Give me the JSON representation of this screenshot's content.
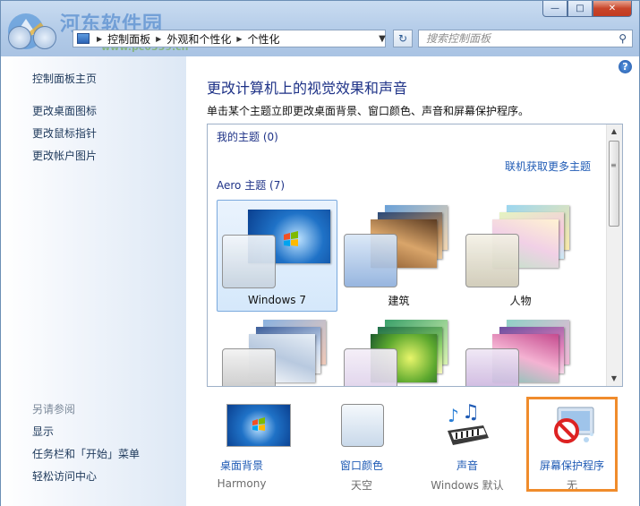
{
  "watermark": {
    "site": "河东软件园",
    "url": "www.pc0359.cn"
  },
  "breadcrumb": [
    "控制面板",
    "外观和个性化",
    "个性化"
  ],
  "search": {
    "placeholder": "搜索控制面板"
  },
  "sidebar": {
    "home": "控制面板主页",
    "links": [
      "更改桌面图标",
      "更改鼠标指针",
      "更改帐户图片"
    ],
    "see_also_heading": "另请参阅",
    "see_also": [
      "显示",
      "任务栏和「开始」菜单",
      "轻松访问中心"
    ]
  },
  "main": {
    "title": "更改计算机上的视觉效果和声音",
    "description": "单击某个主题立即更改桌面背景、窗口颜色、声音和屏幕保护程序。",
    "my_themes": "我的主题 (0)",
    "online_link": "联机获取更多主题",
    "aero_themes": "Aero 主题 (7)",
    "themes": [
      {
        "name": "Windows 7",
        "selected": true
      },
      {
        "name": "建筑",
        "selected": false
      },
      {
        "name": "人物",
        "selected": false
      },
      {
        "name": "",
        "selected": false
      },
      {
        "name": "",
        "selected": false
      },
      {
        "name": "",
        "selected": false
      }
    ]
  },
  "bottom": {
    "items": [
      {
        "label": "桌面背景",
        "value": "Harmony",
        "icon": "desktop-background-icon"
      },
      {
        "label": "窗口颜色",
        "value": "天空",
        "icon": "window-color-icon"
      },
      {
        "label": "声音",
        "value": "Windows 默认",
        "icon": "sound-icon"
      },
      {
        "label": "屏幕保护程序",
        "value": "无",
        "icon": "screensaver-icon"
      }
    ]
  },
  "caption": {
    "minimize": "—",
    "maximize": "□",
    "close": "✕"
  },
  "help": "?",
  "colors": {
    "accent_link": "#1f5bb5",
    "title": "#1e3287",
    "highlight": "#f08c2c"
  }
}
